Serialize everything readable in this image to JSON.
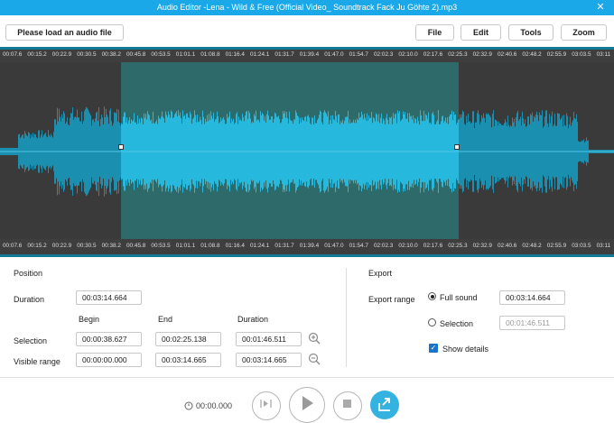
{
  "window": {
    "title": "Audio Editor  -Lena - Wild & Free (Official Video_ Soundtrack Fack Ju Göhte 2).mp3",
    "close_glyph": "✕"
  },
  "toolbar": {
    "load_label": "Please load an audio file",
    "file_label": "File",
    "edit_label": "Edit",
    "tools_label": "Tools",
    "zoom_label": "Zoom"
  },
  "timeline": {
    "ticks": [
      "00:07.6",
      "00:15.2",
      "00:22.9",
      "00:30.5",
      "00:38.2",
      "00:45.8",
      "00:53.5",
      "01:01.1",
      "01:08.8",
      "01:16.4",
      "01:24.1",
      "01:31.7",
      "01:39.4",
      "01:47.0",
      "01:54.7",
      "02:02.3",
      "02:10.0",
      "02:17.6",
      "02:25.3",
      "02:32.9",
      "02:40.6",
      "02:48.2",
      "02:55.9",
      "03:03.5",
      "03:11"
    ]
  },
  "waveform": {
    "unselected_color": "#1b8fb0",
    "selected_color": "#27b8dd",
    "selection_bg": "#2e6a6a"
  },
  "position": {
    "heading": "Position",
    "duration_label": "Duration",
    "duration_value": "00:03:14.664",
    "col_begin": "Begin",
    "col_end": "End",
    "col_duration": "Duration",
    "selection_label": "Selection",
    "selection_begin": "00:00:38.627",
    "selection_end": "00:02:25.138",
    "selection_duration": "00:01:46.511",
    "visible_label": "Visible range",
    "visible_begin": "00:00:00.000",
    "visible_end": "00:03:14.665",
    "visible_duration": "00:03:14.665"
  },
  "export": {
    "heading": "Export",
    "range_label": "Export range",
    "full_sound_label": "Full sound",
    "full_sound_value": "00:03:14.664",
    "selection_label": "Selection",
    "selection_value": "00:01:46.511",
    "show_details_label": "Show details",
    "show_details_checked": true
  },
  "player": {
    "time": "00:00.000"
  }
}
